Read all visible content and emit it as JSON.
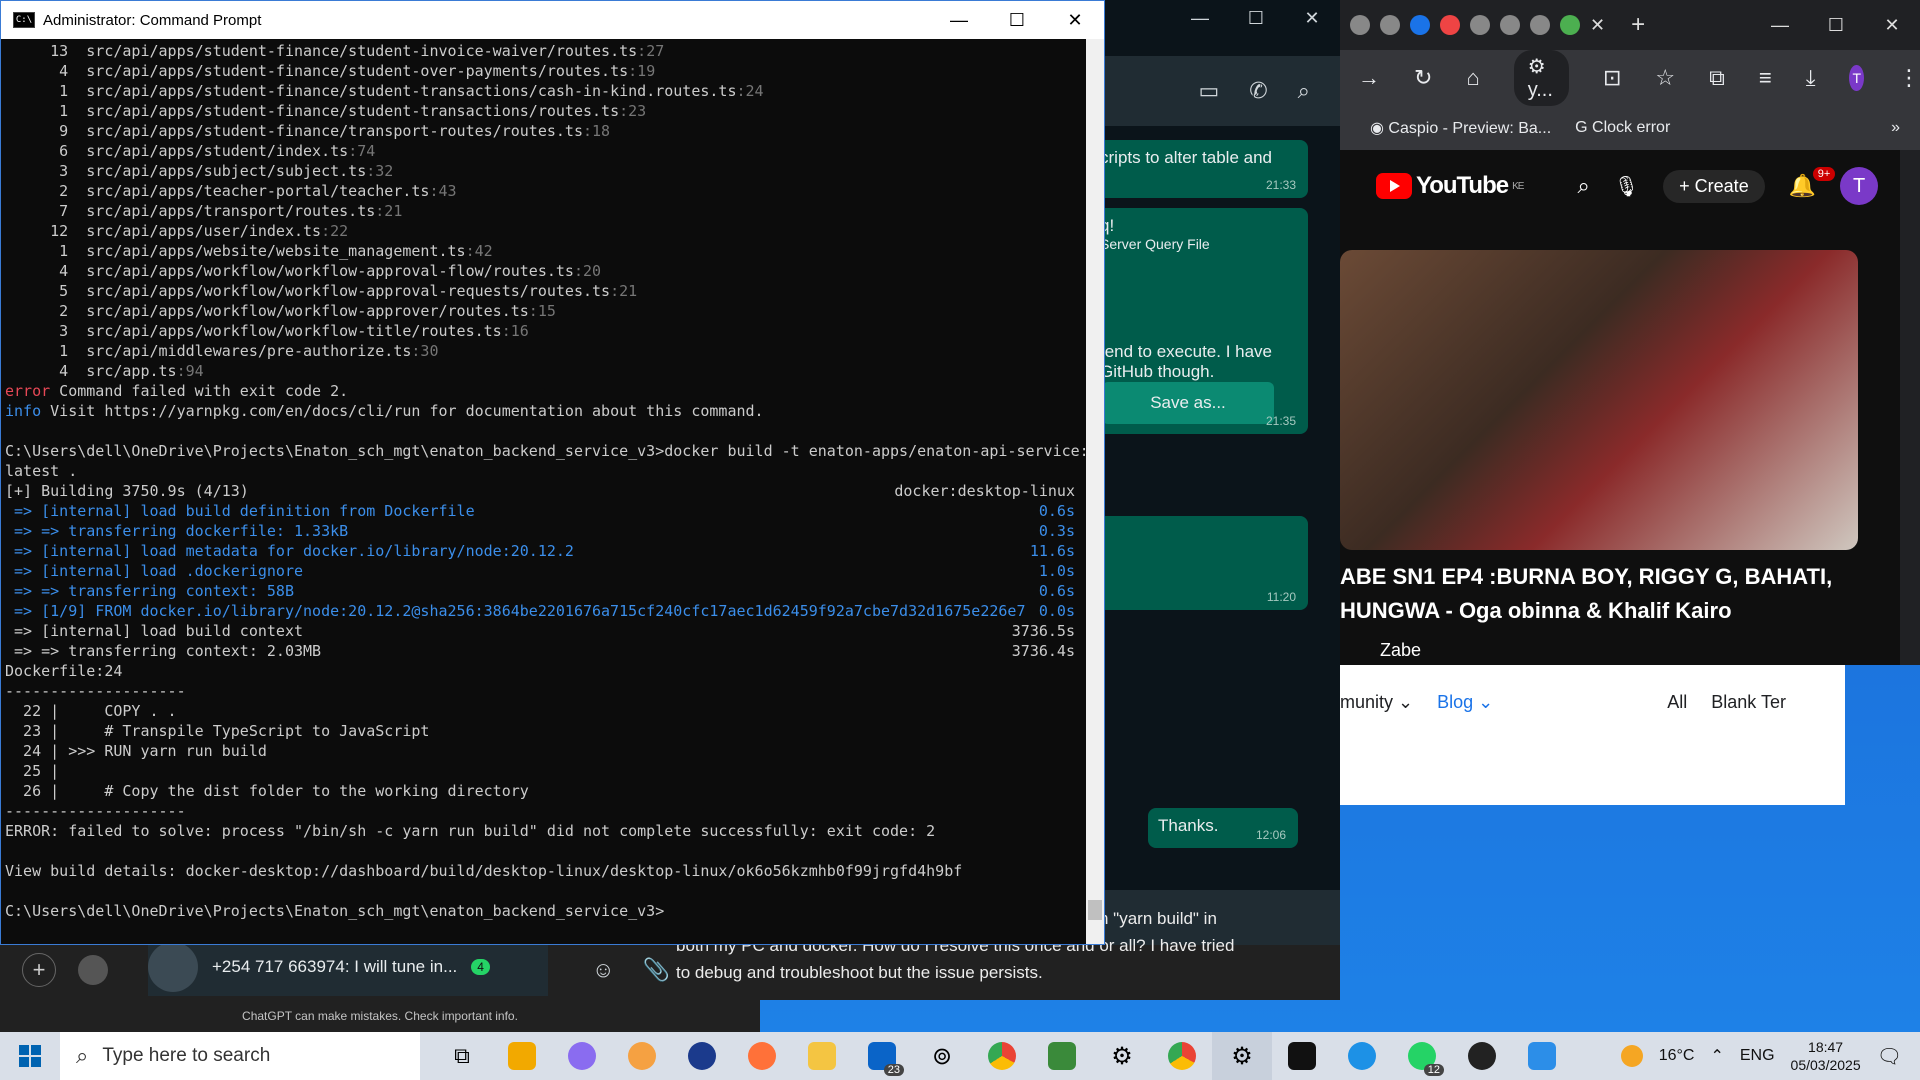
{
  "cmd": {
    "title": "Administrator: Command Prompt",
    "file_lines": [
      {
        "count": "13",
        "path": "src/api/apps/student-finance/student-invoice-waiver/routes.ts",
        "line": ":27"
      },
      {
        "count": "4",
        "path": "src/api/apps/student-finance/student-over-payments/routes.ts",
        "line": ":19"
      },
      {
        "count": "1",
        "path": "src/api/apps/student-finance/student-transactions/cash-in-kind.routes.ts",
        "line": ":24"
      },
      {
        "count": "1",
        "path": "src/api/apps/student-finance/student-transactions/routes.ts",
        "line": ":23"
      },
      {
        "count": "9",
        "path": "src/api/apps/student-finance/transport-routes/routes.ts",
        "line": ":18"
      },
      {
        "count": "6",
        "path": "src/api/apps/student/index.ts",
        "line": ":74"
      },
      {
        "count": "3",
        "path": "src/api/apps/subject/subject.ts",
        "line": ":32"
      },
      {
        "count": "2",
        "path": "src/api/apps/teacher-portal/teacher.ts",
        "line": ":43"
      },
      {
        "count": "7",
        "path": "src/api/apps/transport/routes.ts",
        "line": ":21"
      },
      {
        "count": "12",
        "path": "src/api/apps/user/index.ts",
        "line": ":22"
      },
      {
        "count": "1",
        "path": "src/api/apps/website/website_management.ts",
        "line": ":42"
      },
      {
        "count": "4",
        "path": "src/api/apps/workflow/workflow-approval-flow/routes.ts",
        "line": ":20"
      },
      {
        "count": "5",
        "path": "src/api/apps/workflow/workflow-approval-requests/routes.ts",
        "line": ":21"
      },
      {
        "count": "2",
        "path": "src/api/apps/workflow/workflow-approver/routes.ts",
        "line": ":15"
      },
      {
        "count": "3",
        "path": "src/api/apps/workflow/workflow-title/routes.ts",
        "line": ":16"
      },
      {
        "count": "1",
        "path": "src/api/middlewares/pre-authorize.ts",
        "line": ":30"
      },
      {
        "count": "4",
        "path": "src/app.ts",
        "line": ":94"
      }
    ],
    "error_label": "error",
    "error_text": " Command failed with exit code 2.",
    "info_label": "info",
    "info_text": " Visit https://yarnpkg.com/en/docs/cli/run for documentation about this command.",
    "prompt_cmd_1": "C:\\Users\\dell\\OneDrive\\Projects\\Enaton_sch_mgt\\enaton_backend_service_v3>docker build -t enaton-apps/enaton-api-service:",
    "prompt_cmd_2": "latest .",
    "building": "[+] Building 3750.9s (4/13)",
    "builder": "docker:desktop-linux",
    "steps": [
      {
        "text": " => [internal] load build definition from Dockerfile",
        "time": "0.6s",
        "blue": true
      },
      {
        "text": " => => transferring dockerfile: 1.33kB",
        "time": "0.3s",
        "blue": true
      },
      {
        "text": " => [internal] load metadata for docker.io/library/node:20.12.2",
        "time": "11.6s",
        "blue": true
      },
      {
        "text": " => [internal] load .dockerignore",
        "time": "1.0s",
        "blue": true
      },
      {
        "text": " => => transferring context: 58B",
        "time": "0.6s",
        "blue": true
      },
      {
        "text": " => [1/9] FROM docker.io/library/node:20.12.2@sha256:3864be2201676a715cf240cfc17aec1d62459f92a7cbe7d32d1675e226e7",
        "time": "0.0s",
        "blue": true
      },
      {
        "text": " => [internal] load build context",
        "time": "3736.5s",
        "blue": false
      },
      {
        "text": " => => transferring context: 2.03MB",
        "time": "3736.4s",
        "blue": false
      }
    ],
    "dockerfile_ref": "Dockerfile:24",
    "separator": "--------------------",
    "code_lines": [
      "  22 |     COPY . .",
      "  23 |     # Transpile TypeScript to JavaScript",
      "  24 | >>> RUN yarn run build",
      "  25 |",
      "  26 |     # Copy the dist folder to the working directory"
    ],
    "error_solve": "ERROR: failed to solve: process \"/bin/sh -c yarn run build\" did not complete successfully: exit code: 2",
    "view_details": "View build details: docker-desktop://dashboard/build/desktop-linux/desktop-linux/ok6o56kzmhb0f99jrgfd4h9bf",
    "final_prompt": "C:\\Users\\dell\\OneDrive\\Projects\\Enaton_sch_mgt\\enaton_backend_service_v3>"
  },
  "whatsapp": {
    "msg1_text": "cripts to alter table and",
    "msg1_time": "21:33",
    "msg2_line1": "q!",
    "msg2_line2": "Server Query File",
    "save_as": "Save as...",
    "msg2_line3": "tend to execute. I have",
    "msg2_line4": "GitHub though.",
    "msg2_time": "21:35",
    "msg3_time": "11:20",
    "msg4_text": "Thanks.",
    "msg4_time": "12:06",
    "chat_preview": "+254 717 663974: I will tune in...",
    "chat_badge": "4"
  },
  "gpt": {
    "input_line1": "n \"yarn build\" in",
    "input_line2": "both my PC and docker. How do I resolve this once and or all? I have tried",
    "input_line3": "to debug and troubleshoot but the issue persists.",
    "disclaimer": "ChatGPT can make mistakes. Check important info."
  },
  "chrome": {
    "omnibox": "y...",
    "profile_initial": "T",
    "bookmark1": "Caspio - Preview: Ba...",
    "bookmark2": "Clock error",
    "yt_logo": "YouTube",
    "yt_region": "KE",
    "create": "Create",
    "bell_badge": "9+",
    "yt_avatar": "T",
    "video_title_1": "ABE SN1 EP4 :BURNA BOY, RIGGY G, BAHATI,",
    "video_title_2": "HUNGWA - Oga obinna & Khalif Kairo",
    "channel": "Zabe",
    "web_nav": {
      "community": "munity",
      "blog": "Blog",
      "all": "All",
      "blank": "Blank Ter"
    }
  },
  "taskbar": {
    "search_placeholder": "Type here to search",
    "outlook_badge": "23",
    "whatsapp_badge": "12",
    "weather": "16°C",
    "lang": "ENG",
    "time": "18:47",
    "date": "05/03/2025"
  }
}
